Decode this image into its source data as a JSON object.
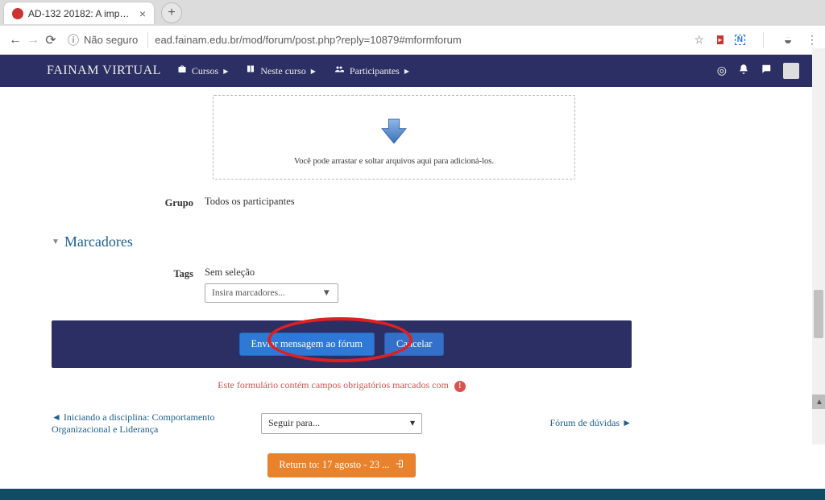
{
  "browser": {
    "tab_title": "AD-132 20182: A importância d",
    "url_insecure_label": "Não seguro",
    "url": "ead.fainam.edu.br/mod/forum/post.php?reply=10879#mformforum"
  },
  "nav": {
    "brand": "FAINAM VIRTUAL",
    "courses": "Cursos",
    "this_course": "Neste curso",
    "participants": "Participantes",
    "user_name": ""
  },
  "dropzone": {
    "hint": "Você pode arrastar e soltar arquivos aqui para adicioná-los."
  },
  "group": {
    "label": "Grupo",
    "value": "Todos os participantes"
  },
  "markers": {
    "title": "Marcadores",
    "tags_label": "Tags",
    "no_selection": "Sem seleção",
    "placeholder": "Insira marcadores..."
  },
  "actions": {
    "submit": "Enviar mensagem ao fórum",
    "cancel": "Cancelar",
    "required_note": "Este formulário contém campos obrigatórios marcados com"
  },
  "bottom_nav": {
    "prev": "Iniciando a disciplina: Comportamento Organizacional e Liderança",
    "jump_placeholder": "Seguir para...",
    "next": "Fórum de dúvidas",
    "return": "Return to: 17 agosto - 23 ..."
  }
}
